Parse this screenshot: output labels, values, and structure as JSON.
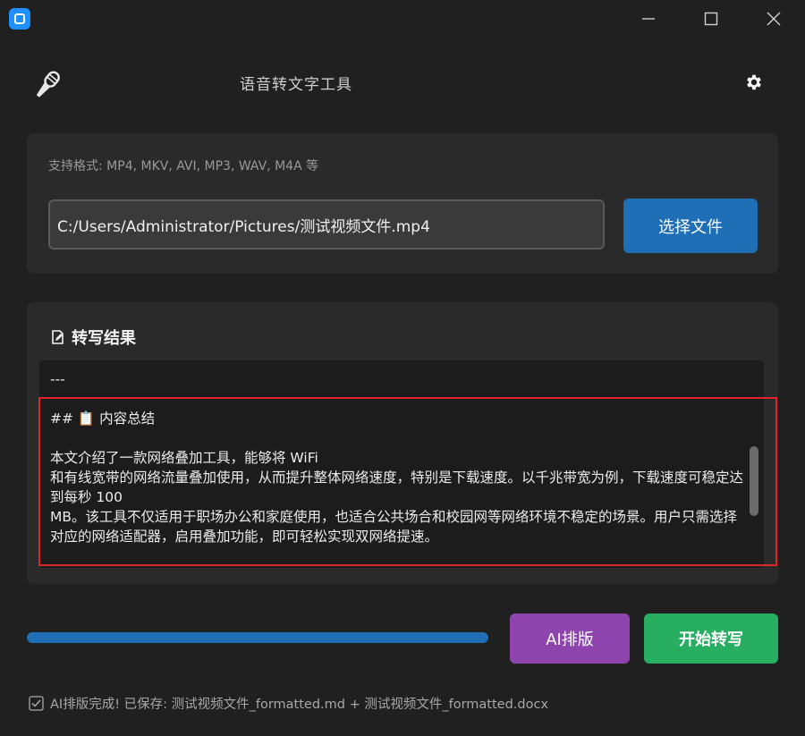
{
  "header": {
    "title": "语音转文字工具"
  },
  "file_panel": {
    "formats_label": "支持格式: MP4, MKV, AVI, MP3, WAV, M4A 等",
    "path_value": "C:/Users/Administrator/Pictures/测试视频文件.mp4",
    "choose_button": "选择文件"
  },
  "result_panel": {
    "heading": "转写结果",
    "text": "---\n\n## 📋 内容总结\n\n本文介绍了一款网络叠加工具，能够将 WiFi\n和有线宽带的网络流量叠加使用，从而提升整体网络速度，特别是下载速度。以千兆带宽为例，下载速度可稳定达到每秒 100\nMB。该工具不仅适用于职场办公和家庭使用，也适合公共场合和校园网等网络环境不稳定的场景。用户只需选择对应的网络适配器，启用叠加功能，即可轻松实现双网络提速。"
  },
  "progress": {
    "value": 1.0
  },
  "actions": {
    "ai_button": "AI排版",
    "start_button": "开始转写"
  },
  "status": {
    "message": "AI排版完成! 已保存: 测试视频文件_formatted.md + 测试视频文件_formatted.docx"
  },
  "colors": {
    "accent_blue": "#1e6fb6",
    "ai_purple": "#8e44ad",
    "start_green": "#27ae60",
    "highlight_red": "#e0242a"
  }
}
